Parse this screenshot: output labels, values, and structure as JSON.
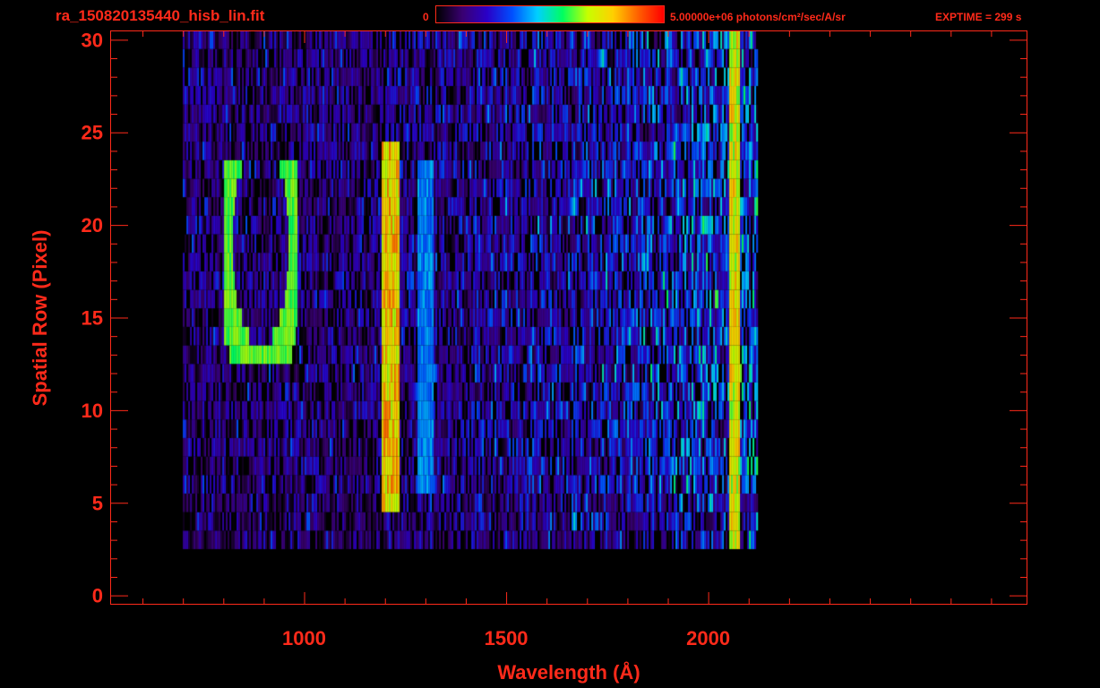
{
  "header": {
    "filename": "ra_150820135440_hisb_lin.fit",
    "colorbar_min_label": "0",
    "colorbar_max_label": "5.00000e+06 photons/cm²/sec/A/sr",
    "exptime_label": "EXPTIME = 299 s"
  },
  "colors": {
    "axis": "#ff2a1a",
    "background": "#000000",
    "colormap": [
      "#000000",
      "#3a0070",
      "#2a00c8",
      "#0050ff",
      "#00d0ff",
      "#00ff60",
      "#c8ff00",
      "#ffd000",
      "#ff6000",
      "#ff0000"
    ]
  },
  "chart_data": {
    "type": "heatmap",
    "title": "ra_150820135440_hisb_lin.fit",
    "xlabel": "Wavelength (Å)",
    "ylabel": "Spatial Row (Pixel)",
    "xlim": [
      520,
      2790
    ],
    "ylim": [
      -0.5,
      30.5
    ],
    "x_ticks": [
      1000,
      1500,
      2000
    ],
    "y_ticks": [
      0,
      5,
      10,
      15,
      20,
      25,
      30
    ],
    "colorbar": {
      "min": 0,
      "max": 5000000,
      "units": "photons/cm²/sec/A/sr"
    },
    "data_extent": {
      "x": [
        700,
        2120
      ],
      "rows": [
        3,
        30
      ]
    },
    "features": [
      {
        "name": "Lyman-beta arc",
        "x": [
          800,
          980
        ],
        "rows": [
          13,
          23
        ],
        "intensity": 0.55
      },
      {
        "name": "Lyman-alpha line",
        "x": [
          1190,
          1235
        ],
        "rows": [
          5,
          24
        ],
        "intensity": 0.8
      },
      {
        "name": "1304 line",
        "x": [
          1280,
          1320
        ],
        "rows": [
          6,
          23
        ],
        "intensity": 0.4
      },
      {
        "name": "Long-wavelength edge",
        "x": [
          2050,
          2075
        ],
        "rows": [
          3,
          30
        ],
        "intensity": 0.75
      }
    ],
    "grid": false,
    "legend": "colorbar top-center"
  }
}
